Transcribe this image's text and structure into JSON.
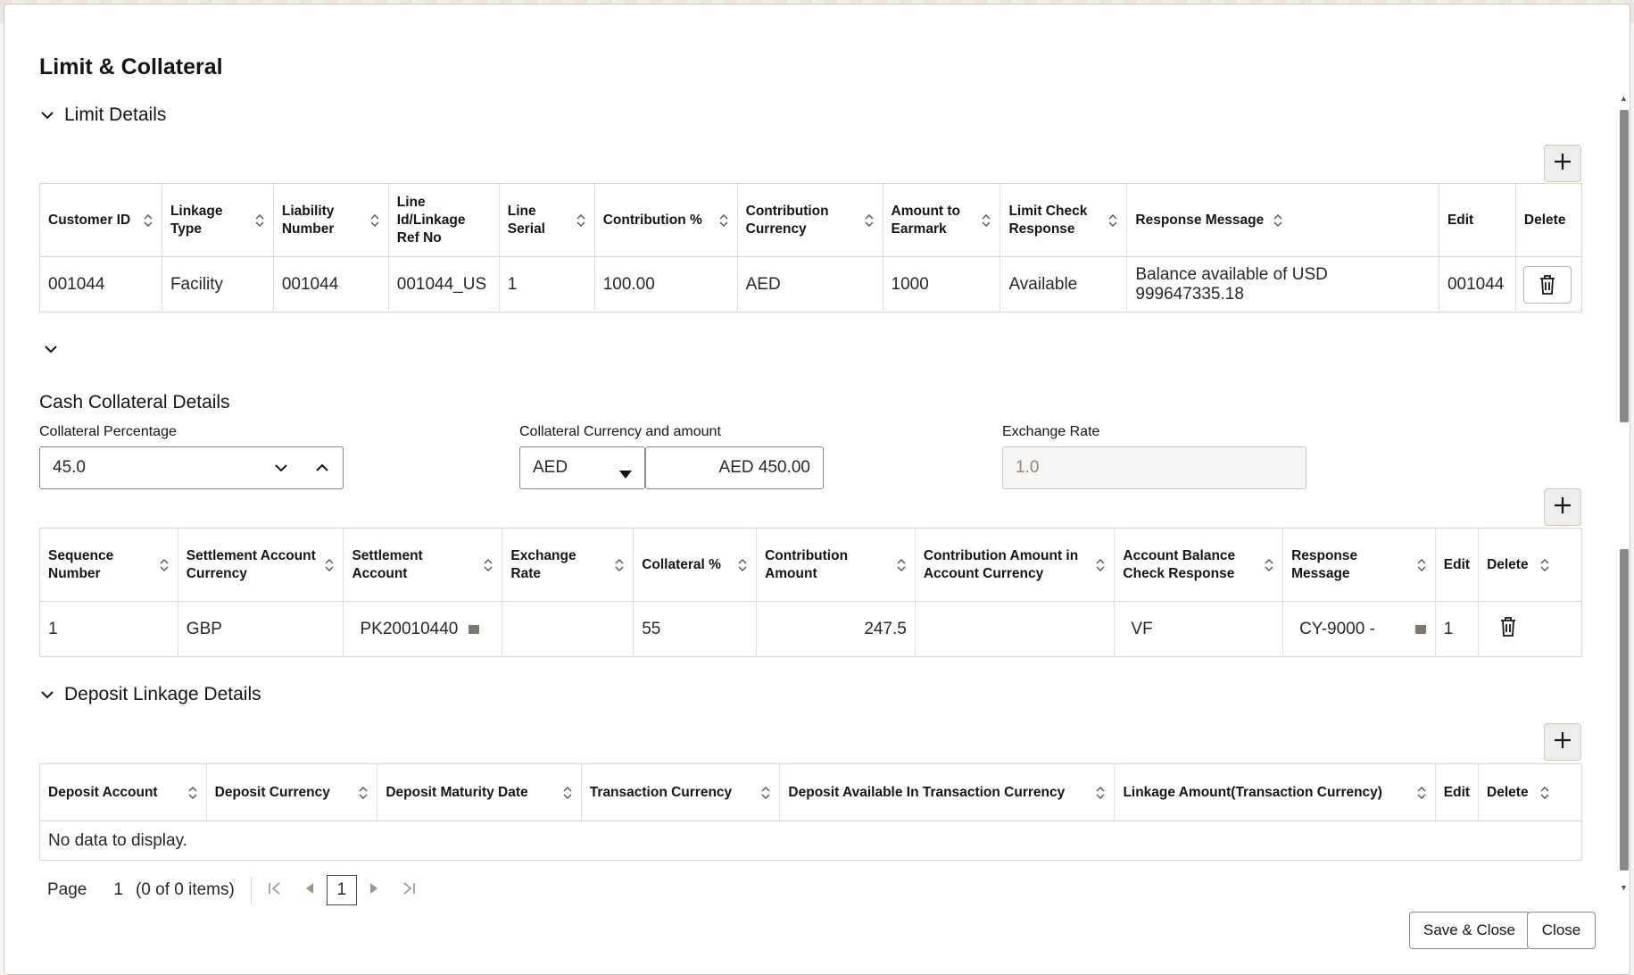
{
  "dialog": {
    "title": "Limit & Collateral"
  },
  "limit_details": {
    "section_title": "Limit Details",
    "columns": [
      "Customer ID",
      "Linkage Type",
      "Liability Number",
      "Line Id/Linkage Ref No",
      "Line Serial",
      "Contribution %",
      "Contribution Currency",
      "Amount to Earmark",
      "Limit Check Response",
      "Response Message",
      "Edit",
      "Delete"
    ],
    "rows": [
      {
        "customer_id": "001044",
        "linkage_type": "Facility",
        "liability_number": "001044",
        "line_id": "001044_US",
        "line_serial": "1",
        "contribution_pct": "100.00",
        "contribution_currency": "AED",
        "amount_to_earmark": "1000",
        "limit_check_response": "Available",
        "response_message": "Balance available of USD 999647335.18",
        "edit": "001044"
      }
    ]
  },
  "cash_collateral": {
    "section_title": "Cash Collateral Details",
    "collateral_percentage_label": "Collateral Percentage",
    "collateral_percentage_value": "45.0",
    "collateral_currency_label": "Collateral Currency and amount",
    "collateral_currency_value": "AED",
    "collateral_amount_value": "AED 450.00",
    "exchange_rate_label": "Exchange Rate",
    "exchange_rate_value": "1.0",
    "columns": [
      "Sequence Number",
      "Settlement Account Currency",
      "Settlement Account",
      "Exchange Rate",
      "Collateral %",
      "Contribution Amount",
      "Contribution Amount in Account Currency",
      "Account Balance Check Response",
      "Response Message",
      "Edit",
      "Delete"
    ],
    "rows": [
      {
        "sequence_number": "1",
        "settlement_account_currency": "GBP",
        "settlement_account": "PK20010440",
        "exchange_rate": "",
        "collateral_pct": "55",
        "contribution_amount": "247.5",
        "contribution_amount_acc_ccy": "",
        "balance_check_response": "VF",
        "response_message": "CY-9000 -",
        "edit": "1"
      }
    ]
  },
  "deposit_linkage": {
    "section_title": "Deposit Linkage Details",
    "columns": [
      "Deposit Account",
      "Deposit Currency",
      "Deposit Maturity Date",
      "Transaction Currency",
      "Deposit Available In Transaction Currency",
      "Linkage Amount(Transaction Currency)",
      "Edit",
      "Delete"
    ],
    "empty_message": "No data to display.",
    "pager": {
      "page_label": "Page",
      "page_value": "1",
      "items_text": "(0 of 0 items)",
      "current_page": "1"
    }
  },
  "footer": {
    "save_close_label": "Save & Close",
    "close_label": "Close"
  },
  "icons": {
    "collapse": "chevron-down-icon",
    "add": "plus-icon",
    "delete": "trash-icon",
    "sort": "sort-icon"
  },
  "colors": {
    "link": "#227096",
    "text": "#161513",
    "border": "#d8d5d1"
  }
}
